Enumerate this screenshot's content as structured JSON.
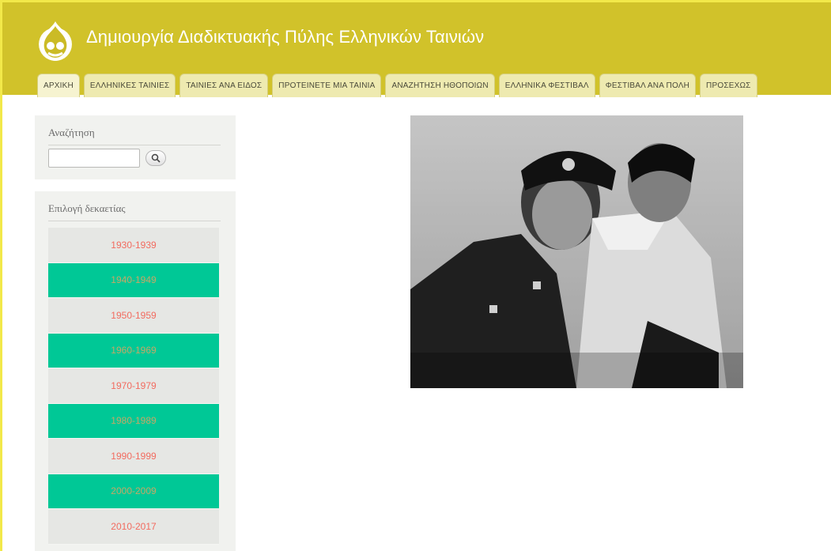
{
  "header": {
    "site_title": "Δημιουργία Διαδικτυακής Πύλης Ελληνικών Ταινιών",
    "logo_icon": "drupal-drop-logo-icon",
    "background_color": "#d1c22a"
  },
  "nav": {
    "tabs": [
      {
        "label": "ΑΡΧΙΚΗ"
      },
      {
        "label": "ΕΛΛΗΝΙΚΕΣ ΤΑΙΝΙΕΣ"
      },
      {
        "label": "ΤΑΙΝΙΕΣ ΑΝΑ ΕΙΔΟΣ"
      },
      {
        "label": "ΠΡΟΤΕΙΝΕΤΕ ΜΙΑ ΤΑΙΝΙΑ"
      },
      {
        "label": "ΑΝΑΖΗΤΗΣΗ ΗΘΟΠΟΙΩΝ"
      },
      {
        "label": "ΕΛΛΗΝΙΚΑ ΦΕΣΤΙΒΑΛ"
      },
      {
        "label": "ΦΕΣΤΙΒΑΛ ΑΝΑ ΠΟΛΗ"
      },
      {
        "label": "ΠΡΟΣΕΧΩΣ"
      }
    ]
  },
  "search": {
    "title": "Αναζήτηση",
    "input_value": "",
    "button_icon": "search-icon"
  },
  "decades": {
    "title": "Επιλογή δεκαετίας",
    "items": [
      {
        "label": "1930-1939"
      },
      {
        "label": "1940-1949"
      },
      {
        "label": "1950-1959"
      },
      {
        "label": "1960-1969"
      },
      {
        "label": "1970-1979"
      },
      {
        "label": "1980-1989"
      },
      {
        "label": "1990-1999"
      },
      {
        "label": "2000-2009"
      },
      {
        "label": "2010-2017"
      }
    ],
    "accent_color": "#00c896",
    "link_color": "#f26b5f"
  },
  "main": {
    "photo_icon": "black-and-white-movie-still-photo"
  }
}
